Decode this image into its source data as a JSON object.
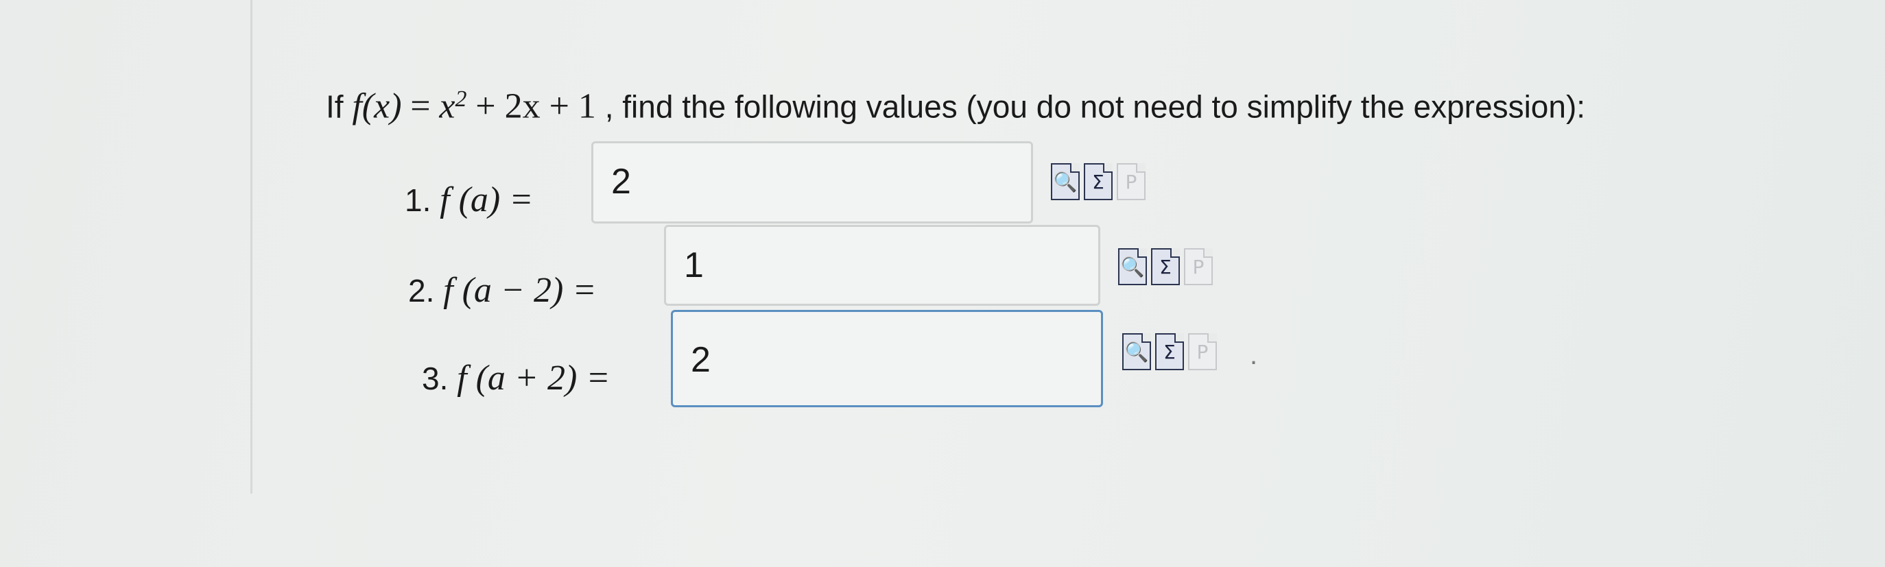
{
  "question": {
    "prefix": "If",
    "func_lhs": "f(x)",
    "equals": "=",
    "x_base": "x",
    "exponent": "2",
    "rest": "+ 2x + 1",
    "suffix": ", find the following values (you do not need to simplify the expression):"
  },
  "items": [
    {
      "number": "1.",
      "expr": "f (a) =",
      "value": "2"
    },
    {
      "number": "2.",
      "expr": "f (a − 2) =",
      "value": "1"
    },
    {
      "number": "3.",
      "expr": "f (a + 2) =",
      "value": "2"
    }
  ],
  "tools": {
    "preview_icon": "magnifier-doc-icon",
    "formula_icon": "sigma-doc-icon",
    "help_icon": "p-doc-icon",
    "preview_glyph": "🔍",
    "formula_glyph": "Σ",
    "help_glyph": "P"
  },
  "trailing": "."
}
